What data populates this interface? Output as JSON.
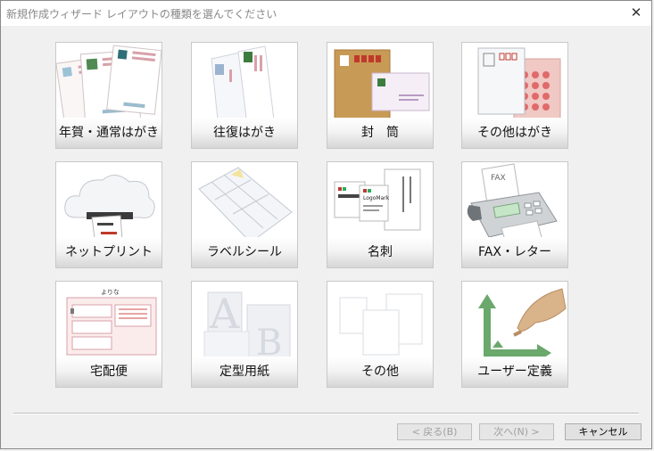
{
  "window": {
    "title": "新規作成ウィザード レイアウトの種類を選んでください"
  },
  "tiles": [
    {
      "label": "年賀・通常はがき",
      "icon": "postcards-icon"
    },
    {
      "label": "往復はがき",
      "icon": "reply-postcard-icon"
    },
    {
      "label": "封　筒",
      "icon": "envelope-icon"
    },
    {
      "label": "その他はがき",
      "icon": "other-postcard-icon"
    },
    {
      "label": "ネットプリント",
      "icon": "cloud-print-icon"
    },
    {
      "label": "ラベルシール",
      "icon": "label-sheet-icon"
    },
    {
      "label": "名刺",
      "icon": "business-card-icon"
    },
    {
      "label": "FAX・レター",
      "icon": "fax-icon"
    },
    {
      "label": "宅配便",
      "icon": "delivery-slip-icon"
    },
    {
      "label": "定型用紙",
      "icon": "standard-paper-icon"
    },
    {
      "label": "その他",
      "icon": "other-layout-icon"
    },
    {
      "label": "ユーザー定義",
      "icon": "user-defined-icon"
    }
  ],
  "art_text": {
    "delivery_slip": "よりな",
    "paper_letters": [
      "A",
      "B"
    ],
    "card_name": "LogoMark",
    "fax_sheet": "FAX"
  },
  "buttons": {
    "back": "< 戻る(B)",
    "next": "次へ(N) >",
    "cancel": "キャンセル"
  }
}
